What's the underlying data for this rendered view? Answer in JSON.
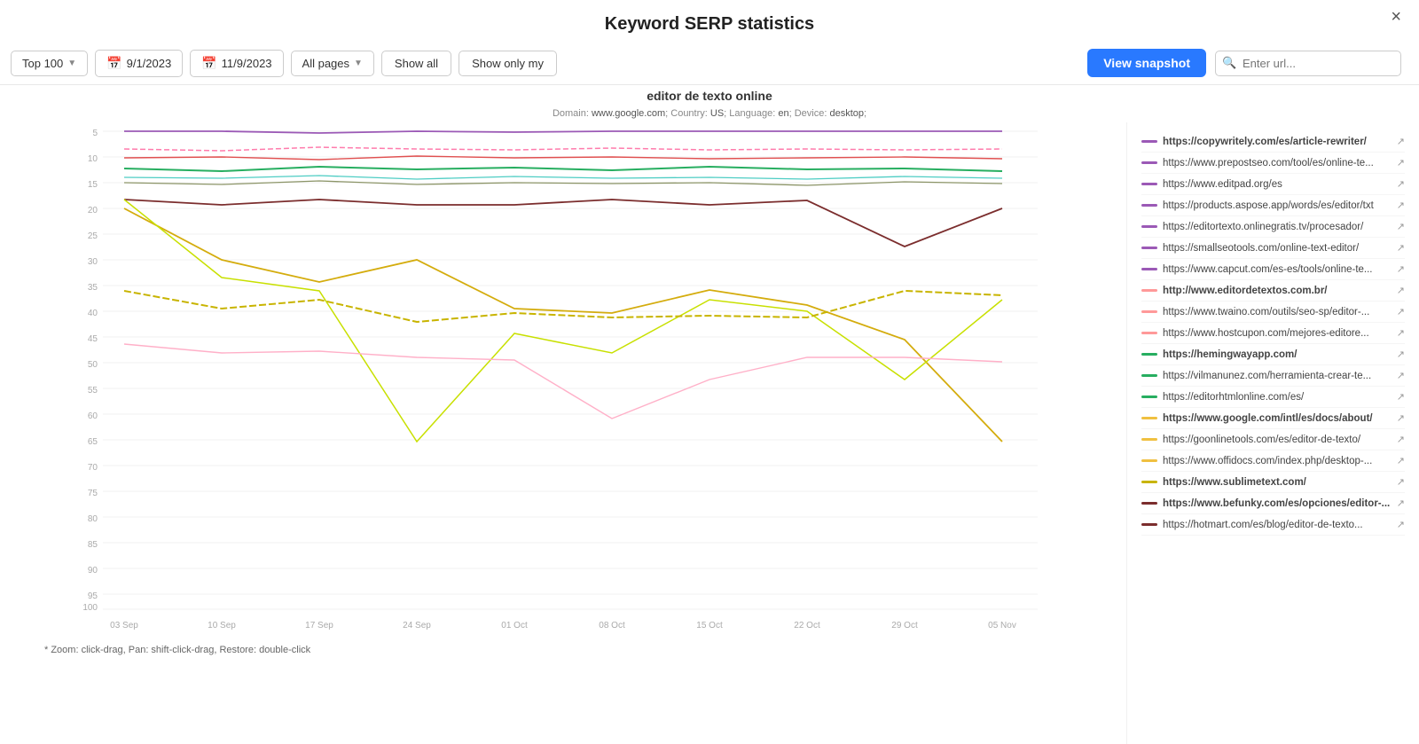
{
  "header": {
    "title": "Keyword SERP statistics",
    "close_label": "×"
  },
  "toolbar": {
    "top100_label": "Top 100",
    "date_start": "9/1/2023",
    "date_end": "11/9/2023",
    "all_pages_label": "All pages",
    "show_all_label": "Show all",
    "show_only_my_label": "Show only my",
    "view_snapshot_label": "View snapshot",
    "search_placeholder": "Enter url..."
  },
  "chart": {
    "title": "editor de texto online",
    "subtitle_domain": "www.google.com",
    "subtitle_country": "US",
    "subtitle_language": "en",
    "subtitle_device": "desktop",
    "hint": "* Zoom: click-drag, Pan: shift-click-drag, Restore: double-click",
    "x_labels": [
      "03 Sep",
      "10 Sep",
      "17 Sep",
      "24 Sep",
      "01 Oct",
      "08 Oct",
      "15 Oct",
      "22 Oct",
      "29 Oct",
      "05 Nov"
    ],
    "y_labels": [
      "5",
      "10",
      "15",
      "20",
      "25",
      "30",
      "35",
      "40",
      "45",
      "50",
      "55",
      "60",
      "65",
      "70",
      "75",
      "80",
      "85",
      "90",
      "95",
      "100"
    ]
  },
  "legend": [
    {
      "url": "https://copywritely.com/es/article-rewriter/",
      "color": "#9B59B6",
      "bold": true
    },
    {
      "url": "https://www.prepostseo.com/tool/es/online-te...",
      "color": "#9B59B6",
      "bold": false
    },
    {
      "url": "https://www.editpad.org/es",
      "color": "#9B59B6",
      "bold": false
    },
    {
      "url": "https://products.aspose.app/words/es/editor/txt",
      "color": "#9B59B6",
      "bold": false
    },
    {
      "url": "https://editortexto.onlinegratis.tv/procesador/",
      "color": "#9B59B6",
      "bold": false
    },
    {
      "url": "https://smallseotools.com/online-text-editor/",
      "color": "#9B59B6",
      "bold": false
    },
    {
      "url": "https://www.capcut.com/es-es/tools/online-te...",
      "color": "#9B59B6",
      "bold": false
    },
    {
      "url": "http://www.editordetextos.com.br/",
      "color": "#FF9999",
      "bold": true
    },
    {
      "url": "https://www.twaino.com/outils/seo-sp/editor-...",
      "color": "#FF9999",
      "bold": false
    },
    {
      "url": "https://www.hostcupon.com/mejores-editore...",
      "color": "#FF9999",
      "bold": false
    },
    {
      "url": "https://hemingwayapp.com/",
      "color": "#27AE60",
      "bold": true
    },
    {
      "url": "https://vilmanunez.com/herramienta-crear-te...",
      "color": "#27AE60",
      "bold": false
    },
    {
      "url": "https://editorhtmlonline.com/es/",
      "color": "#27AE60",
      "bold": false
    },
    {
      "url": "https://www.google.com/intl/es/docs/about/",
      "color": "#F0C040",
      "bold": true
    },
    {
      "url": "https://goonlinetools.com/es/editor-de-texto/",
      "color": "#F0C040",
      "bold": false
    },
    {
      "url": "https://www.offidocs.com/index.php/desktop-...",
      "color": "#F0C040",
      "bold": false
    },
    {
      "url": "https://www.sublimetext.com/",
      "color": "#C8B400",
      "bold": true
    },
    {
      "url": "https://www.befunky.com/es/opciones/editor-...",
      "color": "#7B2D2D",
      "bold": true
    },
    {
      "url": "https://hotmart.com/es/blog/editor-de-texto...",
      "color": "#7B2D2D",
      "bold": false
    }
  ]
}
